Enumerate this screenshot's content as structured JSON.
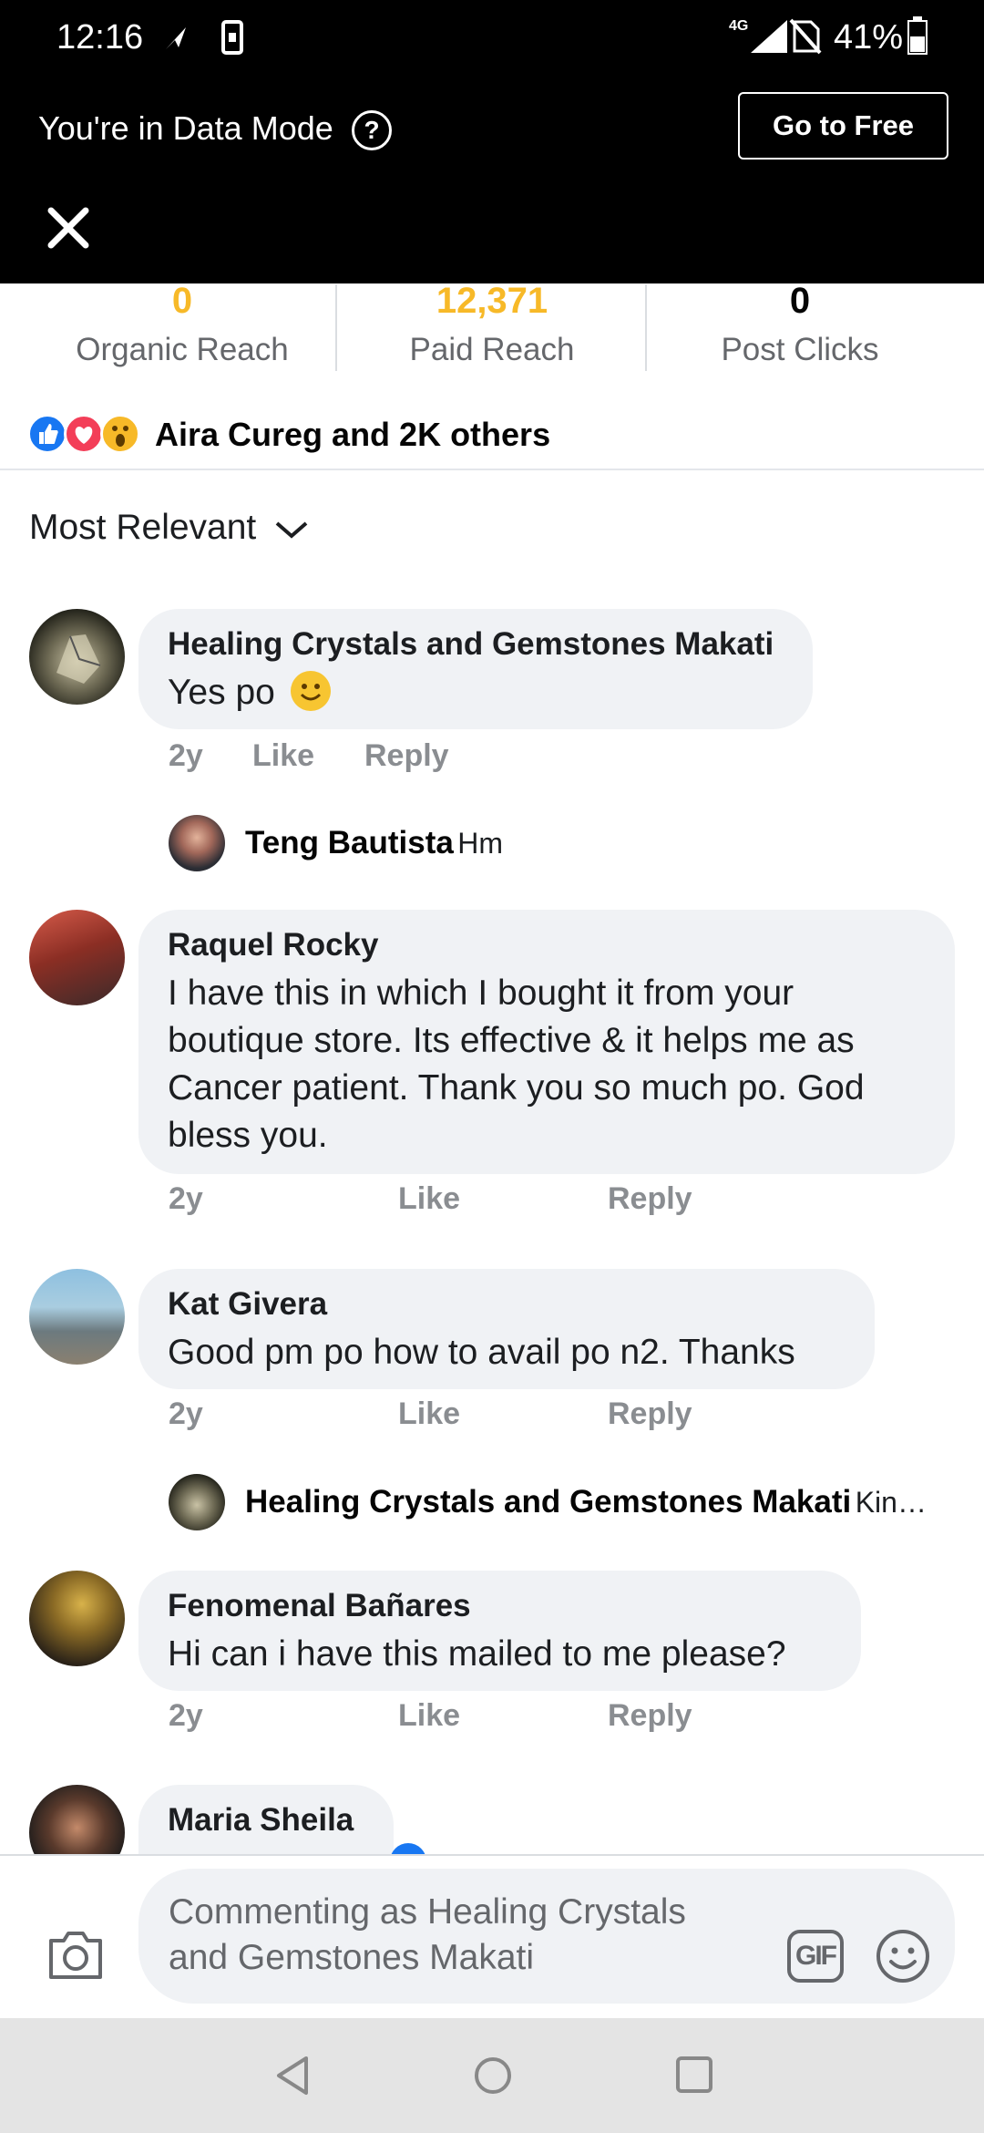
{
  "status_bar": {
    "time": "12:16",
    "network": "4G",
    "battery": "41%"
  },
  "data_mode": {
    "text": "You're in Data Mode",
    "help_icon": "?",
    "button": "Go to Free"
  },
  "stats": [
    {
      "value": "0",
      "label": "Organic Reach",
      "color": "#f7b928"
    },
    {
      "value": "12,371",
      "label": "Paid Reach",
      "color": "#f7b928"
    },
    {
      "value": "0",
      "label": "Post Clicks",
      "color": "#050505"
    }
  ],
  "reactions": {
    "icons": [
      "like-icon",
      "love-icon",
      "wow-icon"
    ],
    "summary": "Aira Cureg and 2K others"
  },
  "sort": {
    "label": "Most Relevant"
  },
  "comments": [
    {
      "name": "Healing Crystals and Gemstones Makati",
      "text": "Yes po",
      "emoji": "😊",
      "time": "2y",
      "like": "Like",
      "reply": "Reply",
      "replies": [
        {
          "name": "Teng Bautista",
          "text": "Hm"
        }
      ]
    },
    {
      "name": "Raquel Rocky",
      "text": "I have this in which I bought it from your boutique store. Its effective & it helps me as Cancer patient. Thank you so much po. God bless you.",
      "time": "2y",
      "like": "Like",
      "reply": "Reply"
    },
    {
      "name": "Kat Givera",
      "text": "Good pm po how to avail po n2. Thanks",
      "time": "2y",
      "like": "Like",
      "reply": "Reply",
      "replies": [
        {
          "name": "Healing Crystals and Gemstones Makati",
          "text": "Kin…"
        }
      ]
    },
    {
      "name": "Fenomenal Bañares",
      "text": "Hi can i have this mailed to me please?",
      "time": "2y",
      "like": "Like",
      "reply": "Reply"
    },
    {
      "name": "Maria Sheila"
    }
  ],
  "composer": {
    "placeholder": "Commenting as Healing Crystals and Gemstones Makati",
    "gif": "GIF"
  },
  "colors": {
    "facebook_blue": "#1877f2",
    "bubble": "#f0f2f5",
    "reach_orange": "#f7b928"
  }
}
